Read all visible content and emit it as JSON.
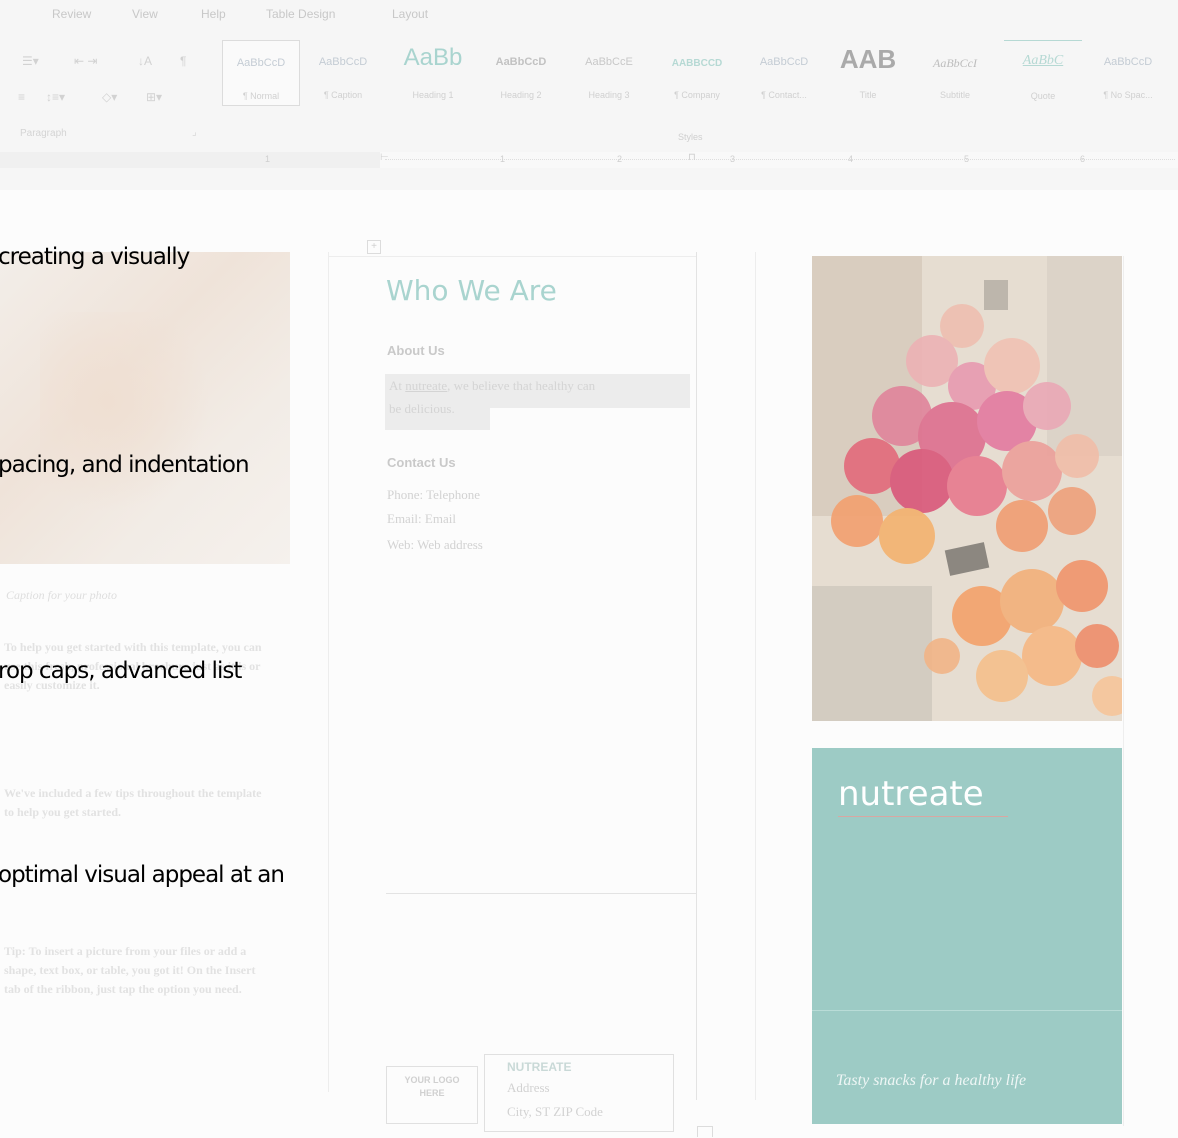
{
  "ribbon": {
    "menu_tabs": [
      "Review",
      "View",
      "Help",
      "Table Design",
      "Layout"
    ],
    "paragraph_group_label": "Paragraph",
    "styles_label": "Styles",
    "styles": [
      {
        "sample": "AaBbCcD",
        "name": "¶ Normal"
      },
      {
        "sample": "AaBbCcD",
        "name": "¶ Caption"
      },
      {
        "sample": "AaBb",
        "name": "Heading 1"
      },
      {
        "sample": "AaBbCcD",
        "name": "Heading 2"
      },
      {
        "sample": "AaBbCcE",
        "name": "Heading 3"
      },
      {
        "sample": "AABBCCD",
        "name": "¶ Company"
      },
      {
        "sample": "AaBbCcD",
        "name": "¶ Contact..."
      },
      {
        "sample": "AAB",
        "name": "Title"
      },
      {
        "sample": "AaBbCcI",
        "name": "Subtitle"
      },
      {
        "sample": "AaBbC",
        "name": "Quote"
      },
      {
        "sample": "AaBbCcD",
        "name": "¶ No Spac..."
      }
    ],
    "ruler_numbers": [
      "1",
      "1",
      "2",
      "3",
      "4",
      "5",
      "6"
    ],
    "accent_color": "#a9d4cf"
  },
  "document": {
    "left_column": {
      "photo_caption": "Caption for your photo",
      "body_1": "To help you get started with this template, you can use this fresh, professional brochure just as it is or easily customize it.",
      "body_2": "We've included a few tips throughout the template to help you get started.",
      "body_3": "Tip: To insert a picture from your files or add a shape, text box, or table, you got it! On the Insert tab of the ribbon, just tap the option you need."
    },
    "middle_column": {
      "title": "Who We Are",
      "about_heading": "About Us",
      "about_prefix": "At ",
      "about_brand": "nutreate",
      "about_line1_rest": ", we believe that healthy can",
      "about_line2": "be delicious.",
      "contact_heading": "Contact Us",
      "phone": "Phone: Telephone",
      "email": "Email: Email",
      "web": "Web: Web address",
      "logo_placeholder": "YOUR LOGO HERE",
      "company": "NUTREATE",
      "address": "Address",
      "city": "City, ST ZIP Code"
    },
    "right_column": {
      "brand": "nutreate",
      "tagline": "Tasty snacks for a healthy life",
      "teal_color": "#9dcbc5"
    }
  },
  "overlay_text": [
    "creating a visually",
    "pacing, and indentation",
    "rop caps, advanced list",
    "optimal visual appeal at an"
  ]
}
